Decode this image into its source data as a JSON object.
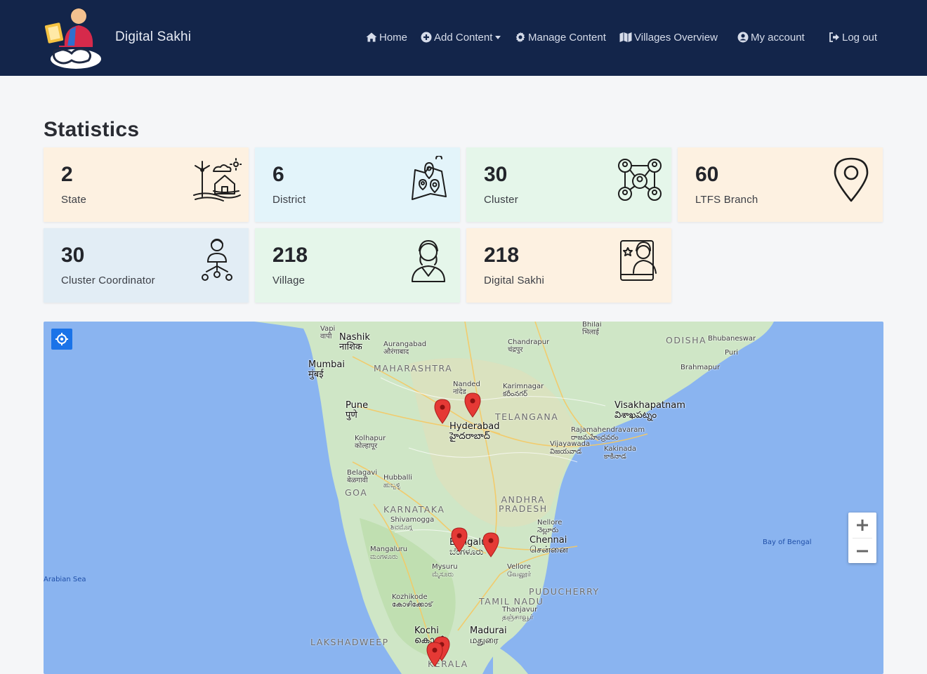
{
  "navbar": {
    "brand": "Digital Sakhi",
    "items": [
      {
        "label": "Home",
        "icon": "home-icon"
      },
      {
        "label": "Add Content",
        "icon": "plus-circle-icon"
      },
      {
        "label": "Manage Content",
        "icon": "gear-icon"
      },
      {
        "label": "Villages Overview",
        "icon": "map-icon"
      },
      {
        "label": "My account",
        "icon": "user-circle-icon"
      },
      {
        "label": "Log out",
        "icon": "logout-icon"
      }
    ]
  },
  "page": {
    "title": "Statistics"
  },
  "stats": [
    {
      "value": "2",
      "label": "State",
      "icon": "farm-house-icon"
    },
    {
      "value": "6",
      "label": "District",
      "icon": "map-pins-icon"
    },
    {
      "value": "30",
      "label": "Cluster",
      "icon": "network-people-icon"
    },
    {
      "value": "60",
      "label": "LTFS Branch",
      "icon": "location-pin-icon"
    },
    {
      "value": "30",
      "label": "Cluster Coordinator",
      "icon": "coordinator-icon"
    },
    {
      "value": "218",
      "label": "Village",
      "icon": "woman-icon"
    },
    {
      "value": "218",
      "label": "Digital Sakhi",
      "icon": "woman-tablet-icon"
    }
  ],
  "map": {
    "labels": {
      "vapi": "Vapi\nवापी",
      "nashik": "Nashik\nनाशिक",
      "aurangabad": "Aurangabad\nऔरंगाबाद",
      "bhilai": "Bhilai\nभिलाई",
      "chandrapur": "Chandrapur\nचंद्रपुर",
      "odisha": "ODISHA",
      "bhubaneswar": "Bhubaneswar",
      "puri": "Puri",
      "brahmapur": "Brahmapur",
      "mumbai": "Mumbai\nमुंबई",
      "maharashtra": "MAHARASHTRA",
      "nanded": "Nanded\nनांदेड",
      "karimnagar": "Karimnagar\nకరీంనగర్",
      "pune": "Pune\nपुणे",
      "hyderabad": "Hyderabad\nహైదరాబాద్",
      "telangana": "TELANGANA",
      "visakhapatnam": "Visakhapatnam\nవిశాఖపట్నం",
      "rajahmundry": "Rajamahendravaram\nరాజమహేంద్రవరం",
      "kolhapur": "Kolhapur\nकोल्हापूर",
      "vijayawada": "Vijayawada\nవిజయవాడ",
      "kakinada": "Kakinada\nకాకినాడ",
      "belagavi": "Belagavi\nबेळगावी",
      "hubballi": "Hubballi\nಹುಬ್ಬಳ್ಳಿ",
      "goa": "GOA",
      "karnataka": "KARNATAKA",
      "andhra": "ANDHRA\nPRADESH",
      "shivamogga": "Shivamogga\nಶಿವಮೊಗ್ಗ",
      "nellore": "Nellore\nనెల్లూరు",
      "bengaluru": "Bengaluru\nಬೆಂಗಳೂರು",
      "chennai": "Chennai\nசென்னை",
      "mangaluru": "Mangaluru\nಮಂಗಳೂರು",
      "bay": "Bay of Bengal",
      "arabian": "Arabian Sea",
      "mysuru": "Mysuru\nಮೈಸೂರು",
      "vellore": "Vellore\nவேலூர்",
      "puducherry": "PUDUCHERRY",
      "kozhikode": "Kozhikode\nകോഴിക്കോട്",
      "tamilnadu": "TAMIL NADU",
      "thanjavur": "Thanjavur\nதஞ்சாவூர்",
      "kochi": "Kochi\nകൊച്ചി",
      "madurai": "Madurai\nமதுரை",
      "lakshadweep": "LAKSHADWEEP",
      "kerala": "KERALA"
    }
  }
}
